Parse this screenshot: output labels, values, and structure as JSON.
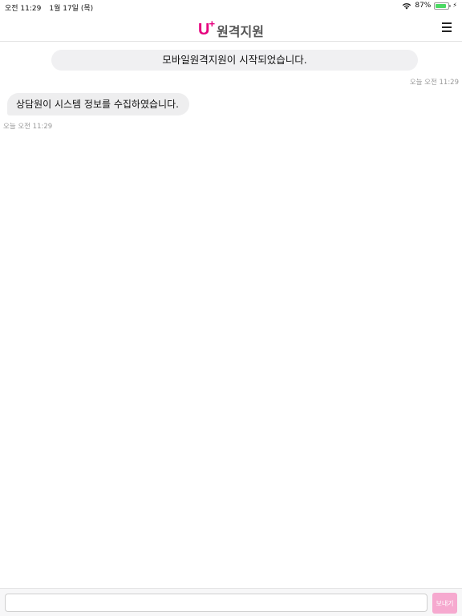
{
  "status_bar": {
    "time": "오전 11:29",
    "date": "1월 17일 (목)",
    "battery_percent_label": "87%",
    "battery_level": 0.87,
    "wifi_icon": "wifi-icon",
    "charging_icon": "bolt-icon"
  },
  "header": {
    "logo_u": "U",
    "logo_plus": "+",
    "logo_name": "원격지원",
    "menu_icon": "hamburger-menu-icon",
    "brand_color": "#e6007e"
  },
  "chat": {
    "messages": [
      {
        "type": "system",
        "text": "모바일원격지원이 시작되었습니다.",
        "timestamp": "오늘 오전 11:29"
      },
      {
        "type": "agent",
        "text": "상담원이 시스템 정보를 수집하였습니다.",
        "timestamp": "오늘 오전 11:29"
      }
    ]
  },
  "composer": {
    "input_value": "",
    "placeholder": "",
    "send_label": "보내기",
    "send_color": "#f6a9cf"
  }
}
